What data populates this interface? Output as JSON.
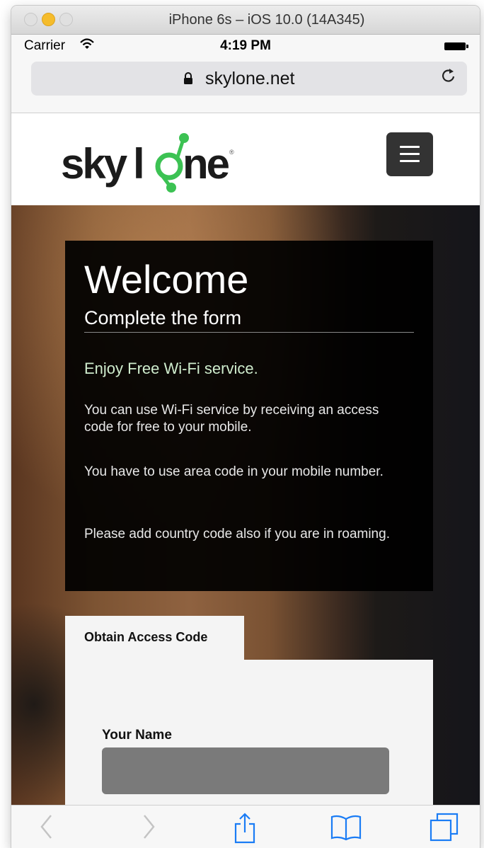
{
  "window": {
    "title": "iPhone 6s – iOS 10.0 (14A345)"
  },
  "status_bar": {
    "carrier": "Carrier",
    "time": "4:19 PM"
  },
  "address_bar": {
    "url": "skylone.net"
  },
  "site": {
    "logo_text": "skylone",
    "welcome": {
      "heading": "Welcome",
      "subheading": "Complete the form",
      "highlight": "Enjoy Free Wi-Fi service.",
      "paragraphs": [
        "You can use Wi-Fi service by receiving an access code for free to your mobile.",
        "You have to use area code in your mobile number.",
        "Please add country code also if you are in roaming."
      ]
    },
    "form": {
      "tab_label": "Obtain Access Code",
      "name_label": "Your Name",
      "name_value": ""
    }
  },
  "icons": {
    "status": [
      "wifi-icon",
      "battery-icon"
    ],
    "address": [
      "lock-icon",
      "reload-icon"
    ],
    "toolbar": [
      "back-icon",
      "forward-icon",
      "share-icon",
      "bookmarks-icon",
      "tabs-icon"
    ]
  },
  "colors": {
    "brand_green": "#3cc253",
    "overlay": "#000000",
    "highlight_text": "#cfeccd"
  }
}
